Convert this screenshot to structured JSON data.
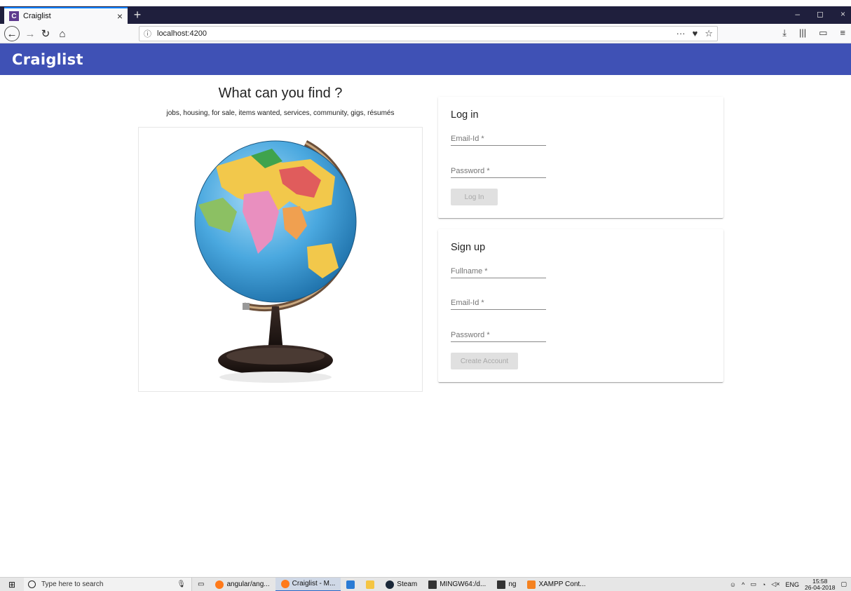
{
  "browser": {
    "tab_title": "Craiglist",
    "tab_favicon": "C",
    "tab_close": "×",
    "new_tab": "+",
    "url": "localhost:4200",
    "window_minimize": "–",
    "window_restore": "◻",
    "window_close": "×"
  },
  "app": {
    "logo": "Craiglist",
    "accent_color": "#3f51b5"
  },
  "hero": {
    "title": "What can you find ?",
    "subtitle": "jobs, housing, for sale, items wanted, services, community, gigs, résumés",
    "image": "globe-image"
  },
  "login": {
    "title": "Log in",
    "email_placeholder": "Email-Id *",
    "password_placeholder": "Password *",
    "button": "Log In"
  },
  "signup": {
    "title": "Sign up",
    "fullname_placeholder": "Fullname *",
    "email_placeholder": "Email-Id *",
    "password_placeholder": "Password *",
    "button": "Create Account"
  },
  "taskbar": {
    "search_placeholder": "Type here to search",
    "items": [
      {
        "label": "angular/ang...",
        "icon": "firefox-icon"
      },
      {
        "label": "Craiglist - M...",
        "icon": "firefox-icon"
      },
      {
        "label": "",
        "icon": "vscode-icon"
      },
      {
        "label": "",
        "icon": "file-explorer-icon"
      },
      {
        "label": "Steam",
        "icon": "steam-icon"
      },
      {
        "label": "MINGW64:/d...",
        "icon": "terminal-icon"
      },
      {
        "label": "ng",
        "icon": "terminal-icon"
      },
      {
        "label": "XAMPP Cont...",
        "icon": "xampp-icon"
      }
    ],
    "language": "ENG",
    "time": "15:58",
    "date": "26-04-2018"
  }
}
